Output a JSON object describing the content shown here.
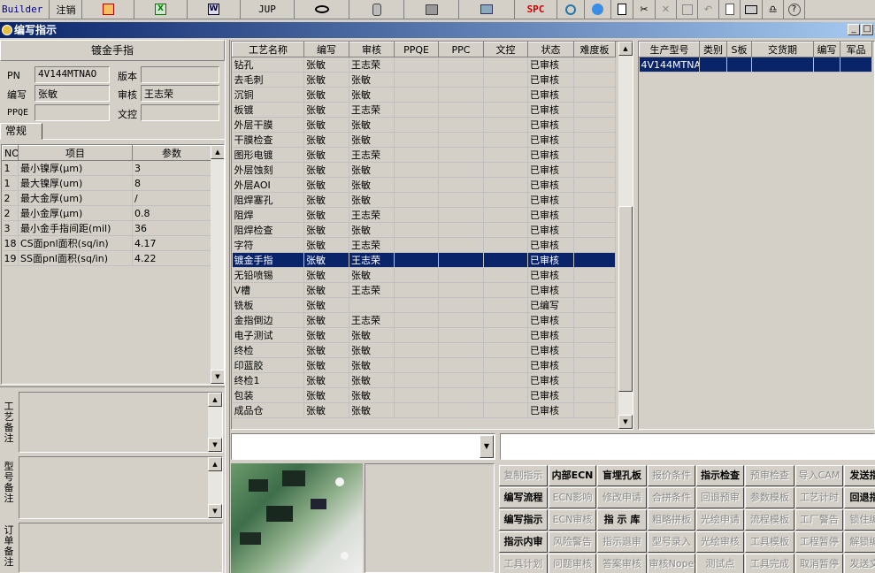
{
  "toolbar": {
    "builder": "Builder",
    "logout": "注销",
    "jup": "JUP",
    "spc": "SPC"
  },
  "window": {
    "title": "编写指示",
    "min": "_",
    "max": "□"
  },
  "left": {
    "section_title": "镀金手指",
    "pn_label": "PN",
    "pn_value": "4V144MTNAO",
    "version_label": "版本",
    "version_value": "",
    "writer_label": "编写",
    "writer_value": "张敏",
    "review_label": "审核",
    "review_value": "王志荣",
    "ppqe_label": "PPQE",
    "ppqe_value": "",
    "doc_label": "文控",
    "doc_value": "",
    "tab_general": "常规",
    "param_headers": [
      "NO",
      "项目",
      "参数"
    ],
    "params": [
      {
        "no": "1",
        "item": "最小镍厚(μm)",
        "val": "3"
      },
      {
        "no": "1",
        "item": "最大镍厚(um)",
        "val": "8"
      },
      {
        "no": "2",
        "item": "最大金厚(um)",
        "val": "/"
      },
      {
        "no": "2",
        "item": "最小金厚(μm)",
        "val": "0.8"
      },
      {
        "no": "3",
        "item": "最小金手指间距(mil)",
        "val": "36"
      },
      {
        "no": "18",
        "item": "CS面pnl面积(sq/in)",
        "val": "4.17"
      },
      {
        "no": "19",
        "item": "SS面pnl面积(sq/in)",
        "val": "4.22"
      }
    ],
    "note1_label": "工艺备注",
    "note2_label": "型号备注",
    "note3_label": "订单备注"
  },
  "process_grid": {
    "headers": [
      "工艺名称",
      "编写",
      "审核",
      "PPQE",
      "PPC",
      "文控",
      "状态",
      "难度板"
    ],
    "rows": [
      [
        "钻孔",
        "张敏",
        "王志荣",
        "",
        "",
        "",
        "已审核",
        ""
      ],
      [
        "去毛刺",
        "张敏",
        "张敏",
        "",
        "",
        "",
        "已审核",
        ""
      ],
      [
        "沉铜",
        "张敏",
        "张敏",
        "",
        "",
        "",
        "已审核",
        ""
      ],
      [
        "板镀",
        "张敏",
        "王志荣",
        "",
        "",
        "",
        "已审核",
        ""
      ],
      [
        "外层干膜",
        "张敏",
        "张敏",
        "",
        "",
        "",
        "已审核",
        ""
      ],
      [
        "干膜检查",
        "张敏",
        "张敏",
        "",
        "",
        "",
        "已审核",
        ""
      ],
      [
        "图形电镀",
        "张敏",
        "王志荣",
        "",
        "",
        "",
        "已审核",
        ""
      ],
      [
        "外层蚀刻",
        "张敏",
        "张敏",
        "",
        "",
        "",
        "已审核",
        ""
      ],
      [
        "外层AOI",
        "张敏",
        "张敏",
        "",
        "",
        "",
        "已审核",
        ""
      ],
      [
        "阻焊塞孔",
        "张敏",
        "张敏",
        "",
        "",
        "",
        "已审核",
        ""
      ],
      [
        "阻焊",
        "张敏",
        "王志荣",
        "",
        "",
        "",
        "已审核",
        ""
      ],
      [
        "阻焊检查",
        "张敏",
        "张敏",
        "",
        "",
        "",
        "已审核",
        ""
      ],
      [
        "字符",
        "张敏",
        "王志荣",
        "",
        "",
        "",
        "已审核",
        ""
      ],
      [
        "镀金手指",
        "张敏",
        "王志荣",
        "",
        "",
        "",
        "已审核",
        ""
      ],
      [
        "无铅喷锡",
        "张敏",
        "张敏",
        "",
        "",
        "",
        "已审核",
        ""
      ],
      [
        "V槽",
        "张敏",
        "王志荣",
        "",
        "",
        "",
        "已审核",
        ""
      ],
      [
        "铣板",
        "张敏",
        "",
        "",
        "",
        "",
        "已编写",
        ""
      ],
      [
        "金指倒边",
        "张敏",
        "王志荣",
        "",
        "",
        "",
        "已审核",
        ""
      ],
      [
        "电子测试",
        "张敏",
        "张敏",
        "",
        "",
        "",
        "已审核",
        ""
      ],
      [
        "终检",
        "张敏",
        "张敏",
        "",
        "",
        "",
        "已审核",
        ""
      ],
      [
        "印蓝胶",
        "张敏",
        "张敏",
        "",
        "",
        "",
        "已审核",
        ""
      ],
      [
        "终检1",
        "张敏",
        "张敏",
        "",
        "",
        "",
        "已审核",
        ""
      ],
      [
        "包装",
        "张敏",
        "张敏",
        "",
        "",
        "",
        "已审核",
        ""
      ],
      [
        "成品仓",
        "张敏",
        "张敏",
        "",
        "",
        "",
        "已审核",
        ""
      ]
    ],
    "selected_row": 13
  },
  "model_grid": {
    "headers": [
      "生产型号",
      "类别",
      "S板",
      "交货期",
      "编写",
      "军品"
    ],
    "rows": [
      [
        "4V144MTNAO",
        "",
        "",
        "",
        "",
        ""
      ]
    ]
  },
  "buttons": [
    [
      "复制指示",
      "内部ECN",
      "盲埋孔板",
      "报价条件",
      "指示检查",
      "预审检查",
      "导入CAM",
      "发送指"
    ],
    [
      "编写流程",
      "ECN影响",
      "修改申请",
      "合拼条件",
      "回退预审",
      "参数模板",
      "工艺计时",
      "回退指"
    ],
    [
      "编写指示",
      "ECN审核",
      "指 示 库",
      "粗略拼板",
      "光绘申请",
      "流程模板",
      "工厂警告",
      "锁住编"
    ],
    [
      "指示内审",
      "风险警告",
      "指示退审",
      "型号录入",
      "光绘审核",
      "工具模板",
      "工程暂停",
      "解锁编"
    ],
    [
      "工具计划",
      "问题审核",
      "答案审核",
      "审核Nope",
      "测试点",
      "工具完成",
      "取消暂停",
      "发送文"
    ]
  ],
  "button_enabled": [
    [
      false,
      true,
      true,
      false,
      true,
      false,
      false,
      true
    ],
    [
      true,
      false,
      false,
      false,
      false,
      false,
      false,
      true
    ],
    [
      true,
      false,
      true,
      false,
      false,
      false,
      false,
      false
    ],
    [
      true,
      false,
      false,
      false,
      false,
      false,
      false,
      false
    ],
    [
      false,
      false,
      false,
      false,
      false,
      false,
      false,
      false
    ]
  ]
}
